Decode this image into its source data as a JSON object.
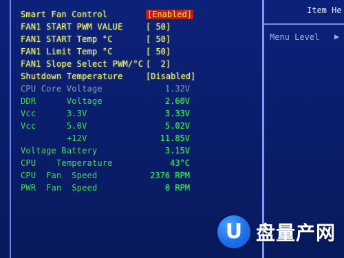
{
  "colors": {
    "background": "#0c227a",
    "setting_text": "#f4f56a",
    "reading_text": "#45e84c",
    "disabled_text": "#8f9bb8",
    "selection_highlight": "#b81f1c",
    "frame_line": "#8aa0ff"
  },
  "settings": [
    {
      "label": "Smart Fan Control",
      "value": "[Enabled]",
      "selected": true
    },
    {
      "label": "FAN1 START PWM VALUE",
      "value": "[ 50]"
    },
    {
      "label": "FAN1 START Temp °C",
      "value": "[ 50]"
    },
    {
      "label": "FAN1 Limit Temp °C",
      "value": "[ 50]"
    },
    {
      "label": "FAN1 Slope Select PWM/°C",
      "value": "[  2]"
    },
    {
      "label": "Shutdown Temperature",
      "value": "[Disabled]"
    }
  ],
  "readings": [
    {
      "label": "CPU Core Voltage",
      "value": "1.32V",
      "style": "gray"
    },
    {
      "label": "DDR      Voltage",
      "value": "2.60V",
      "style": "green"
    },
    {
      "label": "Vcc      3.3V",
      "value": "3.33V",
      "style": "green"
    },
    {
      "label": "Vcc      5.0V",
      "value": "5.02V",
      "style": "green"
    },
    {
      "label": "         +12V",
      "value": "11.85V",
      "style": "green"
    },
    {
      "label": "Voltage Battery",
      "value": "3.15V",
      "style": "green"
    },
    {
      "label": "CPU    Temperature",
      "value": "43°C",
      "style": "green"
    },
    {
      "label": "CPU  Fan  Speed",
      "value": "2376 RPM",
      "style": "green"
    },
    {
      "label": "PWR  Fan  Speed",
      "value": "0 RPM",
      "style": "green"
    }
  ],
  "help_panel": {
    "title": "Item He",
    "menu_level_label": "Menu Level",
    "menu_level_arrow": "▶"
  },
  "watermark": {
    "logo_letter": "U",
    "text": "盘量产网"
  }
}
